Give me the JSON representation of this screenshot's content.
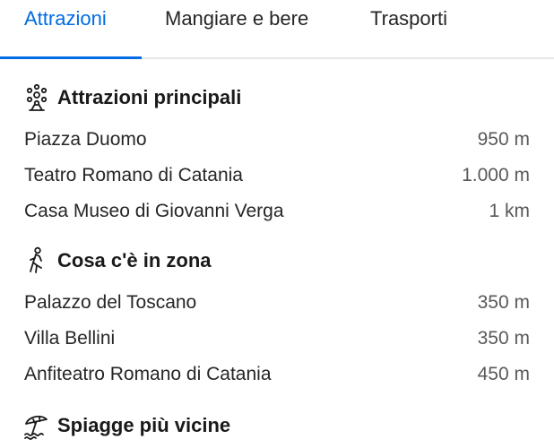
{
  "tabs": [
    {
      "label": "Attrazioni",
      "active": true
    },
    {
      "label": "Mangiare e bere",
      "active": false
    },
    {
      "label": "Trasporti",
      "active": false
    }
  ],
  "sections": [
    {
      "title": "Attrazioni principali",
      "icon": "ferris-wheel-icon",
      "items": [
        {
          "name": "Piazza Duomo",
          "distance": "950 m"
        },
        {
          "name": "Teatro Romano di Catania",
          "distance": "1.000 m"
        },
        {
          "name": "Casa Museo di Giovanni Verga",
          "distance": "1 km"
        }
      ]
    },
    {
      "title": "Cosa c'è in zona",
      "icon": "walking-person-icon",
      "items": [
        {
          "name": "Palazzo del Toscano",
          "distance": "350 m"
        },
        {
          "name": "Villa Bellini",
          "distance": "350 m"
        },
        {
          "name": "Anfiteatro Romano di Catania",
          "distance": "450 m"
        }
      ]
    },
    {
      "title": "Spiagge più vicine",
      "icon": "beach-umbrella-icon",
      "items": []
    }
  ],
  "colors": {
    "accent": "#006ce4",
    "text": "#262626",
    "muted": "#595959"
  }
}
